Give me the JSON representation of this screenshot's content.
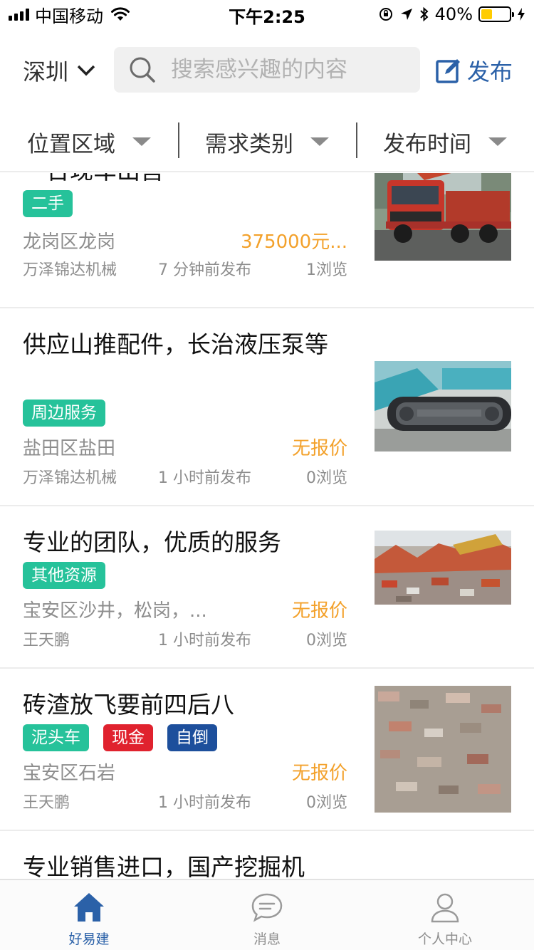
{
  "status_bar": {
    "carrier": "中国移动",
    "time": "下午2:25",
    "battery": "40%",
    "battery_level": 0.4
  },
  "header": {
    "city": "深圳",
    "search_placeholder": "搜索感兴趣的内容",
    "publish_label": "发布"
  },
  "filters": [
    {
      "label": "位置区域"
    },
    {
      "label": "需求类别"
    },
    {
      "label": "发布时间"
    }
  ],
  "listings": [
    {
      "title": "一台现车出售",
      "tags": [
        {
          "label": "二手",
          "color": "#26c29a"
        }
      ],
      "location": "龙岗区龙岗",
      "price": "375000元...",
      "publisher": "万泽锦达机械",
      "published": "7 分钟前发布",
      "views": "1浏览",
      "image": "red-crane-truck"
    },
    {
      "title": "供应山推配件，长治液压泵等",
      "tags": [
        {
          "label": "周边服务",
          "color": "#26c29a"
        }
      ],
      "location": "盐田区盐田",
      "price": "无报价",
      "publisher": "万泽锦达机械",
      "published": "1 小时前发布",
      "views": "0浏览",
      "image": "excavator-track"
    },
    {
      "title": "专业的团队，优质的服务",
      "tags": [
        {
          "label": "其他资源",
          "color": "#26c29a"
        }
      ],
      "location": "宝安区沙井，松岗，...",
      "price": "无报价",
      "publisher": "王天鹏",
      "published": "1 小时前发布",
      "views": "0浏览",
      "image": "brick-rubble-pile"
    },
    {
      "title": "砖渣放飞要前四后八",
      "tags": [
        {
          "label": "泥头车",
          "color": "#26c29a"
        },
        {
          "label": "现金",
          "color": "#e0222e"
        },
        {
          "label": "自倒",
          "color": "#1d4f9c"
        }
      ],
      "location": "宝安区石岩",
      "price": "无报价",
      "publisher": "王天鹏",
      "published": "1 小时前发布",
      "views": "0浏览",
      "image": "brick-debris-closeup"
    },
    {
      "title": "专业销售进口，国产挖掘机",
      "tags": [],
      "location": "",
      "price": "",
      "publisher": "",
      "published": "",
      "views": "",
      "image": ""
    }
  ],
  "tabbar": [
    {
      "label": "好易建",
      "icon": "home-icon",
      "active": true
    },
    {
      "label": "消息",
      "icon": "message-icon",
      "active": false
    },
    {
      "label": "个人中心",
      "icon": "user-icon",
      "active": false
    }
  ],
  "colors": {
    "brand_blue": "#2b61a8",
    "tag_green": "#26c29a",
    "price_orange": "#f3a12b"
  }
}
